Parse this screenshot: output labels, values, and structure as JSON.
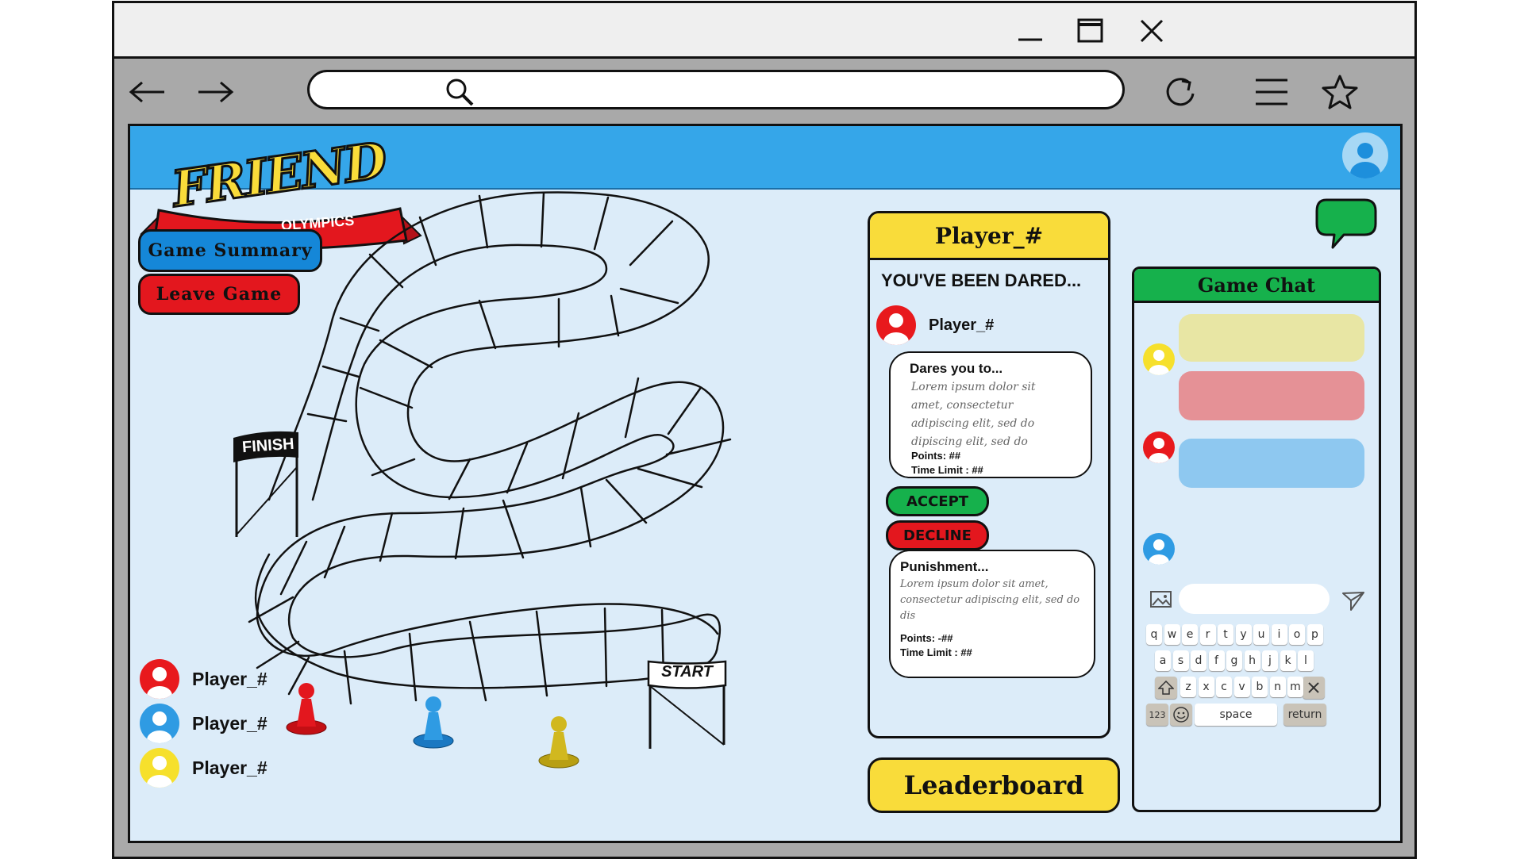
{
  "browser": {
    "url_value": ""
  },
  "app": {
    "logo_word1": "FRIEND",
    "logo_word2": "OLYMPICS",
    "game_summary_label": "Game Summary",
    "leave_game_label": "Leave Game",
    "finish_label": "FINISH",
    "start_label": "START",
    "players": [
      {
        "name": "Player_#",
        "color": "#e8191d"
      },
      {
        "name": "Player_#",
        "color": "#2f9be3"
      },
      {
        "name": "Player_#",
        "color": "#f6e02c"
      }
    ],
    "pieces": [
      {
        "color": "#e8191d"
      },
      {
        "color": "#2f9be3"
      },
      {
        "color": "#d1b81f"
      }
    ]
  },
  "dare": {
    "header": "Player_#",
    "title": "YOU'VE BEEN DARED...",
    "dare_player": "Player_#",
    "dares_heading": "Dares you to...",
    "dares_body": "Lorem ipsum dolor sit amet, consectetur adipiscing elit, sed do dipiscing elit, sed do",
    "dares_points": "Points: ##",
    "dares_time": "Time Limit : ##",
    "accept_label": "ACCEPT",
    "decline_label": "DECLINE",
    "punishment_heading": "Punishment...",
    "punishment_body": "Lorem ipsum dolor sit amet, consectetur adipiscing elit, sed do dis",
    "punishment_points": "Points: -##",
    "punishment_time": "Time Limit : ##"
  },
  "leaderboard_label": "Leaderboard",
  "chat": {
    "title": "Game Chat",
    "messages": [
      {
        "avatar_color": "#f6e02c",
        "bubble_color": "#e8e6a4"
      },
      {
        "avatar_color": "#e8191d",
        "bubble_color": "#e59196"
      },
      {
        "avatar_color": "#2f9be3",
        "bubble_color": "#8ec8f0"
      }
    ],
    "input_value": "",
    "keyboard": {
      "row1": [
        "q",
        "w",
        "e",
        "r",
        "t",
        "y",
        "u",
        "i",
        "o",
        "p"
      ],
      "row2": [
        "a",
        "s",
        "d",
        "f",
        "g",
        "h",
        "j",
        "k",
        "l"
      ],
      "row3": [
        "z",
        "x",
        "c",
        "v",
        "b",
        "n",
        "m"
      ],
      "numbers_key": "123",
      "space_key": "space",
      "return_key": "return"
    }
  },
  "colors": {
    "appbar": "#35a6e9",
    "background": "#dcecf9",
    "accept": "#16b14c",
    "decline": "#e8191d",
    "yellow": "#f9dc3a"
  }
}
